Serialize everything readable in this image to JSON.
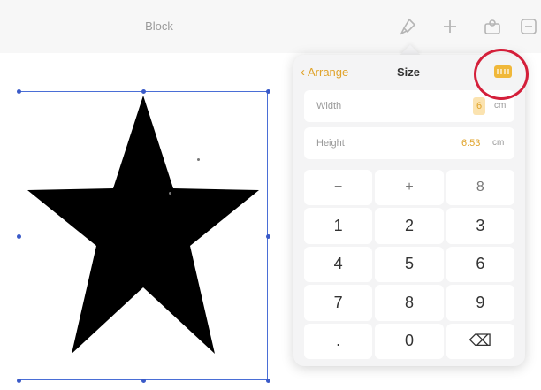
{
  "toolbar": {
    "doc_title": "Block",
    "icons": [
      "paintbrush-icon",
      "plus-icon",
      "share-icon",
      "more-icon"
    ]
  },
  "popover": {
    "back_label": "Arrange",
    "title": "Size",
    "keyboard_icon": "keyboard-icon",
    "fields": [
      {
        "label": "Width",
        "value": "6",
        "unit": "cm"
      },
      {
        "label": "Height",
        "value": "6.53",
        "unit": "cm"
      }
    ],
    "keypad": [
      "−",
      "+",
      "8",
      "1",
      "2",
      "3",
      "4",
      "5",
      "6",
      "7",
      "8",
      "9",
      ".",
      "0",
      "⌫"
    ]
  },
  "colors": {
    "accent": "#e0a32a",
    "selection": "#4a6ed6",
    "annotation_ring": "#d41f3a"
  }
}
